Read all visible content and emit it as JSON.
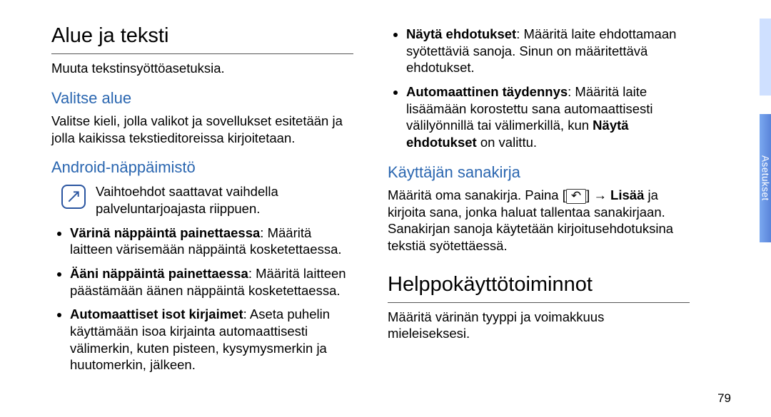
{
  "left": {
    "h1": "Alue ja teksti",
    "intro": "Muuta tekstinsyöttöasetuksia.",
    "s1": {
      "heading": "Valitse alue",
      "body": "Valitse kieli, jolla valikot ja sovellukset esitetään ja jolla kaikissa tekstieditoreissa kirjoitetaan."
    },
    "s2": {
      "heading": "Android-näppäimistö",
      "note": "Vaihtoehdot saattavat vaihdella palveluntarjoajasta riippuen.",
      "items": {
        "i1": {
          "b": "Värinä näppäintä painettaessa",
          "t": ": Määritä laitteen värisemään näppäintä kosketettaessa."
        },
        "i2": {
          "b": "Ääni näppäintä painettaessa",
          "t": ": Määritä laitteen päästämään äänen näppäintä kosketettaessa."
        },
        "i3": {
          "b": "Automaattiset isot kirjaimet",
          "t": ": Aseta puhelin käyttämään isoa kirjainta automaattisesti välimerkin, kuten pisteen, kysymysmerkin ja huutomerkin, jälkeen."
        }
      }
    }
  },
  "right": {
    "s2cont": {
      "i4": {
        "b": "Näytä ehdotukset",
        "t": ": Määritä laite ehdottamaan syötettäviä sanoja. Sinun on määritettävä ehdotukset."
      },
      "i5": {
        "b": "Automaattinen täydennys",
        "t1": ": Määritä laite lisäämään korostettu sana automaattisesti välilyönnillä tai välimerkillä, kun ",
        "b2": "Näytä ehdotukset",
        "t2": " on valittu."
      }
    },
    "s3": {
      "heading": "Käyttäjän sanakirja",
      "t1": "Määritä oma sanakirja. Paina [",
      "key": "↶",
      "t2": "] → ",
      "b": "Lisää",
      "t3": " ja kirjoita sana, jonka haluat tallentaa sanakirjaan. Sanakirjan sanoja käytetään kirjoitusehdotuksina tekstiä syötettäessä."
    },
    "h1_2": "Helppokäyttötoiminnot",
    "body2": "Määritä värinän tyyppi ja voimakkuus mieleiseksesi."
  },
  "pagenum": "79",
  "tab": "Asetukset"
}
